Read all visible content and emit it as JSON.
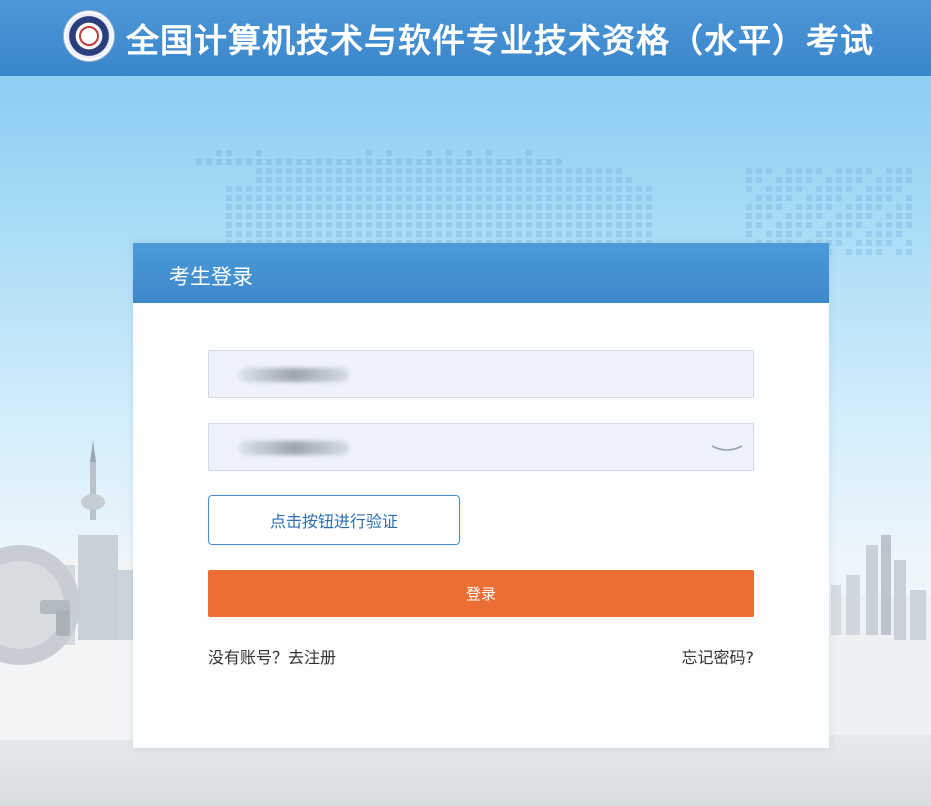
{
  "header": {
    "title": "全国计算机技术与软件专业技术资格（水平）考试",
    "logo_icon": "exam-emblem-logo"
  },
  "login": {
    "title": "考生登录",
    "username_field": {
      "value": "",
      "placeholder": "",
      "masked": true
    },
    "password_field": {
      "value": "",
      "placeholder": "",
      "masked": true,
      "toggle_icon": "eye-closed-icon"
    },
    "verify_button": "点击按钮进行验证",
    "login_button": "登录",
    "register_link": "没有账号？去注册",
    "forgot_link": "忘记密码?"
  },
  "colors": {
    "header_bg": "#3f8bcf",
    "login_button": "#ec6e35",
    "verify_border": "#3f8fd6",
    "field_bg": "#edf2fc"
  }
}
